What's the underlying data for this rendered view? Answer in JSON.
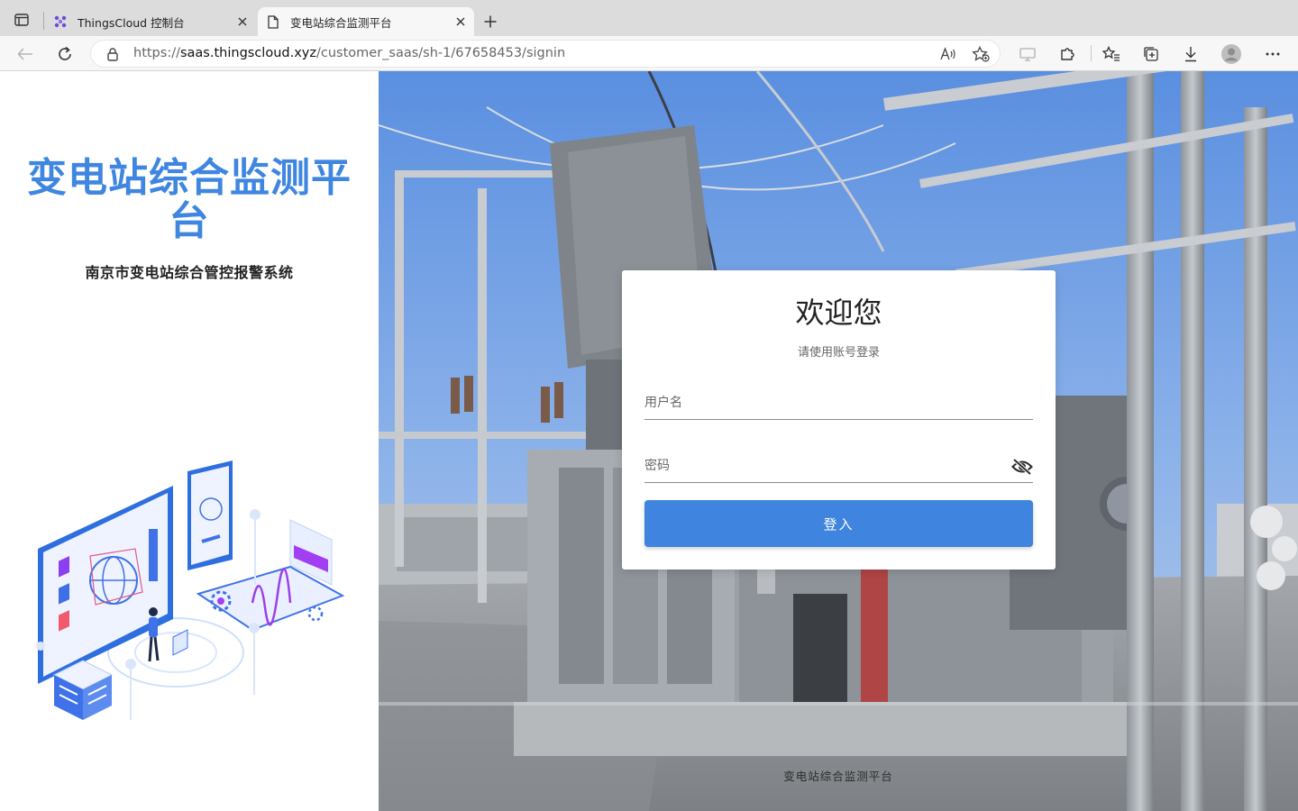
{
  "browser": {
    "tabs": [
      {
        "title": "ThingsCloud 控制台",
        "active": false
      },
      {
        "title": "变电站综合监测平台",
        "active": true
      }
    ],
    "url": {
      "scheme": "https://",
      "host": "saas.thingscloud.xyz",
      "path": "/customer_saas/sh-1/67658453/signin"
    }
  },
  "brand": {
    "title": "变电站综合监测平台",
    "subtitle": "南京市变电站综合管控报警系统"
  },
  "login": {
    "welcome": "欢迎您",
    "hint": "请使用账号登录",
    "username_placeholder": "用户名",
    "password_placeholder": "密码",
    "submit_label": "登入"
  },
  "footer": {
    "text": "变电站综合监测平台"
  },
  "colors": {
    "brand_blue": "#3f86e0",
    "button_blue": "#3f84de"
  }
}
